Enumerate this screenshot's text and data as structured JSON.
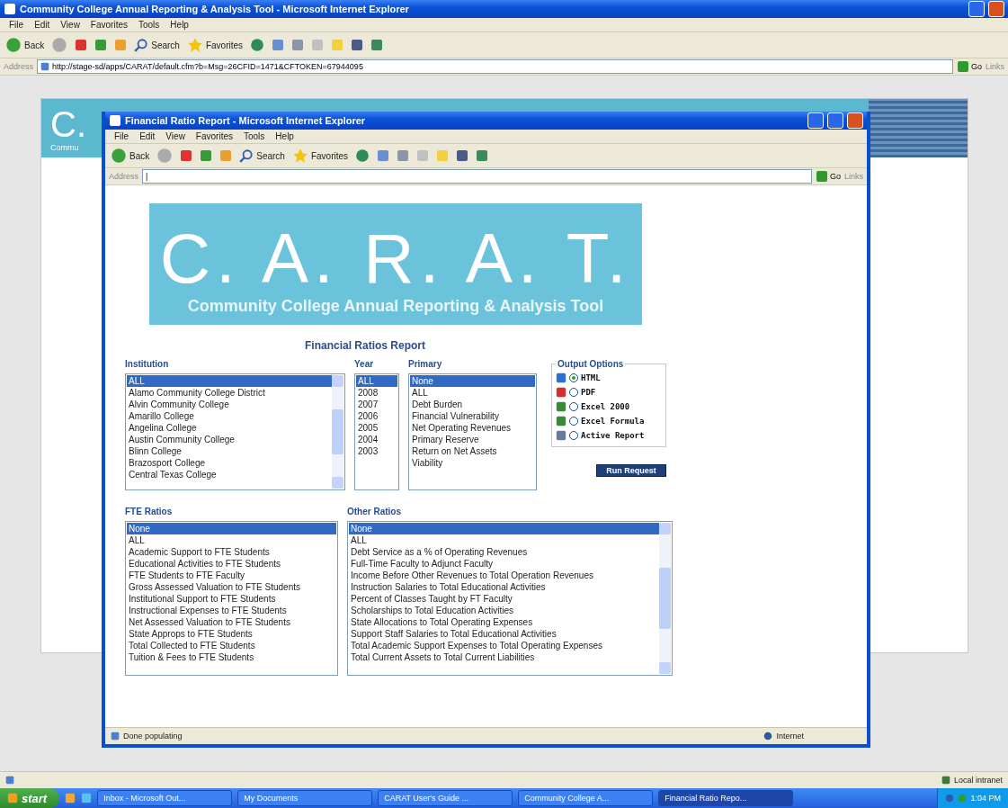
{
  "browser": {
    "title": "Community College Annual Reporting & Analysis Tool - Microsoft Internet Explorer",
    "menu": [
      "File",
      "Edit",
      "View",
      "Favorites",
      "Tools",
      "Help"
    ],
    "toolbar": {
      "back": "Back",
      "search": "Search",
      "favorites": "Favorites"
    },
    "address": {
      "label": "Address",
      "url": "http://stage-sd/apps/CARAT/default.cfm?b=Msg=26CFID=1471&CFTOKEN=67944095"
    },
    "go": "Go",
    "links": "Links",
    "status": "Local intranet"
  },
  "background_page": {
    "logo": "C.",
    "caption": "Commu"
  },
  "popup": {
    "title": "Financial Ratio Report - Microsoft Internet Explorer",
    "menu": [
      "File",
      "Edit",
      "View",
      "Favorites",
      "Tools",
      "Help"
    ],
    "toolbar": {
      "back": "Back",
      "search": "Search",
      "favorites": "Favorites"
    },
    "address": {
      "label": "Address",
      "value": "|"
    },
    "go": "Go",
    "links": "Links",
    "status": "Done populating",
    "zone": "Internet"
  },
  "report": {
    "banner": {
      "letters": "C. A. R. A. T.",
      "subtitle": "Community College Annual Reporting & Analysis Tool"
    },
    "title": "Financial Ratios Report",
    "lists": [
      {
        "label": "Institution",
        "scrollbar": true,
        "items": [
          {
            "text": "ALL",
            "selected": true
          },
          {
            "text": "Alamo Community College District",
            "selected": false
          },
          {
            "text": "Alvin Community College",
            "selected": false
          },
          {
            "text": "Amarillo College",
            "selected": false
          },
          {
            "text": "Angelina College",
            "selected": false
          },
          {
            "text": "Austin Community College",
            "selected": false
          },
          {
            "text": "Blinn College",
            "selected": false
          },
          {
            "text": "Brazosport College",
            "selected": false
          },
          {
            "text": "Central Texas College",
            "selected": false
          }
        ]
      },
      {
        "label": "Year",
        "scrollbar": false,
        "items": [
          {
            "text": "ALL",
            "selected": true
          },
          {
            "text": "2008",
            "selected": false
          },
          {
            "text": "2007",
            "selected": false
          },
          {
            "text": "2006",
            "selected": false
          },
          {
            "text": "2005",
            "selected": false
          },
          {
            "text": "2004",
            "selected": false
          },
          {
            "text": "2003",
            "selected": false
          }
        ]
      },
      {
        "label": "Primary",
        "scrollbar": false,
        "items": [
          {
            "text": "None",
            "selected": true
          },
          {
            "text": "ALL",
            "selected": false
          },
          {
            "text": "Debt Burden",
            "selected": false
          },
          {
            "text": "Financial Vulnerability",
            "selected": false
          },
          {
            "text": "Net Operating Revenues",
            "selected": false
          },
          {
            "text": "Primary Reserve",
            "selected": false
          },
          {
            "text": "Return on Net Assets",
            "selected": false
          },
          {
            "text": "Viability",
            "selected": false
          }
        ]
      },
      {
        "label": "FTE Ratios",
        "scrollbar": false,
        "items": [
          {
            "text": "None",
            "selected": true
          },
          {
            "text": "ALL",
            "selected": false
          },
          {
            "text": "Academic Support to FTE Students",
            "selected": false
          },
          {
            "text": "Educational Activities to FTE Students",
            "selected": false
          },
          {
            "text": "FTE Students to FTE Faculty",
            "selected": false
          },
          {
            "text": "Gross Assessed Valuation to FTE Students",
            "selected": false
          },
          {
            "text": "Institutional Support to FTE Students",
            "selected": false
          },
          {
            "text": "Instructional Expenses to FTE Students",
            "selected": false
          },
          {
            "text": "Net Assessed Valuation to FTE Students",
            "selected": false
          },
          {
            "text": "State Approps to FTE Students",
            "selected": false
          },
          {
            "text": "Total Collected to FTE Students",
            "selected": false
          },
          {
            "text": "Tuition & Fees to FTE Students",
            "selected": false
          }
        ]
      },
      {
        "label": "Other Ratios",
        "scrollbar": true,
        "items": [
          {
            "text": "None",
            "selected": true
          },
          {
            "text": "ALL",
            "selected": false
          },
          {
            "text": "Debt Service as a % of Operating Revenues",
            "selected": false
          },
          {
            "text": "Full-Time Faculty to Adjunct Faculty",
            "selected": false
          },
          {
            "text": "Income Before Other Revenues to Total Operation Revenues",
            "selected": false
          },
          {
            "text": "Instruction Salaries to Total Educational Activities",
            "selected": false
          },
          {
            "text": "Percent of Classes Taught by FT Faculty",
            "selected": false
          },
          {
            "text": "Scholarships to Total Education Activities",
            "selected": false
          },
          {
            "text": "State Allocations to Total Operating Expenses",
            "selected": false
          },
          {
            "text": "Support Staff Salaries to Total Educational Activities",
            "selected": false
          },
          {
            "text": "Total Academic Support Expenses to Total Operating Expenses",
            "selected": false
          },
          {
            "text": "Total Current Assets to Total Current Liabilities",
            "selected": false
          }
        ]
      }
    ],
    "output_options": {
      "legend": "Output Options",
      "options": [
        {
          "label": "HTML",
          "kind": "html",
          "selected": true
        },
        {
          "label": "PDF",
          "kind": "pdf",
          "selected": false
        },
        {
          "label": "Excel 2000",
          "kind": "excel",
          "selected": false
        },
        {
          "label": "Excel Formula",
          "kind": "excel",
          "selected": false
        },
        {
          "label": "Active Report",
          "kind": "active",
          "selected": false
        }
      ]
    },
    "run_button": "Run Request"
  },
  "taskbar": {
    "start": "start",
    "tasks": [
      {
        "label": "Inbox - Microsoft Out...",
        "selected": false
      },
      {
        "label": "My Documents",
        "selected": false
      },
      {
        "label": "CARAT User's Guide ...",
        "selected": false
      },
      {
        "label": "Community College A...",
        "selected": false
      },
      {
        "label": "Financial Ratio Repo...",
        "selected": true
      }
    ],
    "clock": "1:04 PM"
  }
}
